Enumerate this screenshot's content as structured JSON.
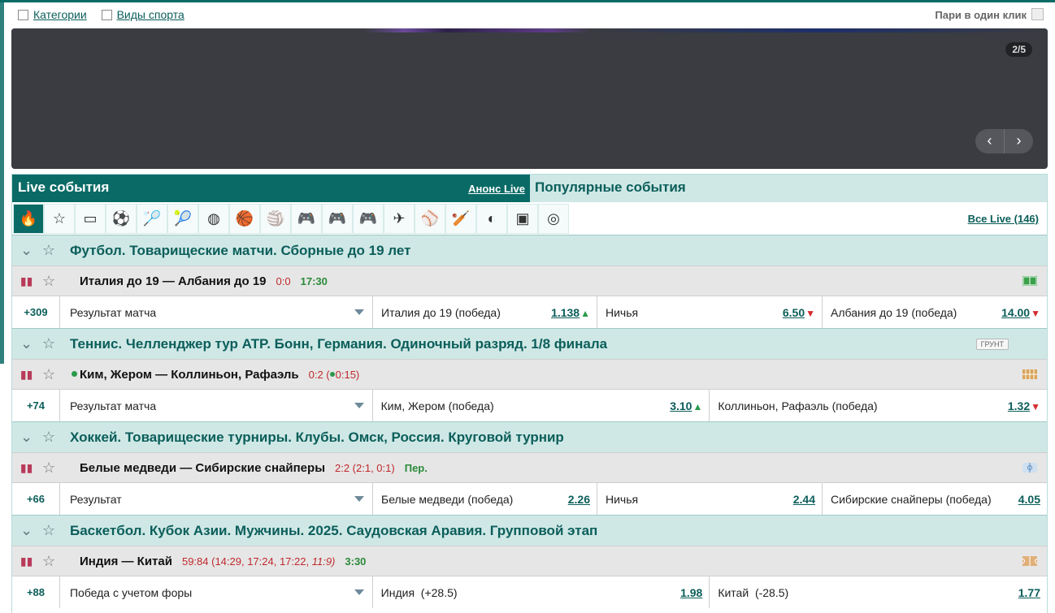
{
  "top": {
    "categories": "Категории",
    "sports": "Виды спорта",
    "one_click": "Пари в один клик"
  },
  "banner": {
    "counter": "2/5",
    "prev": "‹",
    "next": "›"
  },
  "tabs": {
    "live": "Live события",
    "announce": "Анонс Live",
    "popular": "Популярные события",
    "all_live": "Все Live (146)"
  },
  "sport_icons": [
    "fire-icon",
    "star-icon",
    "video-icon",
    "football-icon",
    "badminton-icon",
    "tennis-icon",
    "hockey-icon",
    "basketball-icon",
    "volleyball-icon",
    "esports-icon",
    "esports-2-icon",
    "esports-3-icon",
    "darts-icon",
    "baseball-icon",
    "cricket-icon",
    "beach-volleyball-icon",
    "futsal-icon",
    "table-tennis-icon"
  ],
  "sections": [
    {
      "title": "Футбол. Товарищеские матчи. Сборные до 19 лет",
      "badge": "",
      "match": {
        "name": "Италия до 19 — Албания до 19",
        "score": "0:0",
        "time": "17:30",
        "live_dot": false
      },
      "odds": {
        "more": "+309",
        "market": "Результат матча",
        "cells": [
          {
            "label": "Италия до 19 (победа)",
            "value": "1.138",
            "trend": "up"
          },
          {
            "label": "Ничья",
            "value": "6.50",
            "trend": "down"
          },
          {
            "label": "Албания до 19 (победа)",
            "value": "14.00",
            "trend": "down"
          }
        ]
      }
    },
    {
      "title": "Теннис. Челленджер тур ATP. Бонн, Германия. Одиночный разряд. 1/8 финала",
      "badge": "ГРУНТ",
      "match": {
        "name": "Ким, Жером — Коллиньон, Рафаэль",
        "score": "0:2 (",
        "score_tail": "0:15)",
        "time": "",
        "live_dot": true
      },
      "odds": {
        "more": "+74",
        "market": "Результат матча",
        "cells": [
          {
            "label": "Ким, Жером (победа)",
            "value": "3.10",
            "trend": "up"
          },
          {
            "label": "Коллиньон, Рафаэль (победа)",
            "value": "1.32",
            "trend": "down"
          }
        ]
      }
    },
    {
      "title": "Хоккей. Товарищеские турниры. Клубы. Омск, Россия. Круговой турнир",
      "badge": "",
      "match": {
        "name": "Белые медведи — Сибирские снайперы",
        "score": "2:2 (2:1, 0:1)",
        "time": "Пер.",
        "live_dot": false
      },
      "odds": {
        "more": "+66",
        "market": "Результат",
        "cells": [
          {
            "label": "Белые медведи (победа)",
            "value": "2.26",
            "trend": ""
          },
          {
            "label": "Ничья",
            "value": "2.44",
            "trend": ""
          },
          {
            "label": "Сибирские снайперы (победа)",
            "value": "4.05",
            "trend": ""
          }
        ]
      }
    },
    {
      "title": "Баскетбол. Кубок Азии. Мужчины. 2025. Саудовская Аравия. Групповой этап",
      "badge": "",
      "match": {
        "name": "Индия — Китай",
        "score": "59:84 (14:29, 17:24, 17:22, ",
        "score_tail": "11:9)",
        "time": "3:30",
        "live_dot": false
      },
      "odds": {
        "more": "+88",
        "market": "Победа с учетом форы",
        "cells": [
          {
            "label": "Индия  (+28.5)",
            "value": "1.98",
            "trend": ""
          },
          {
            "label": "Китай  (-28.5)",
            "value": "1.77",
            "trend": ""
          }
        ]
      }
    }
  ],
  "colors": {
    "brand": "#0a6b66",
    "section_bg": "#cfe8e6",
    "score_red": "#c0292c",
    "time_green": "#2a8a3a"
  }
}
